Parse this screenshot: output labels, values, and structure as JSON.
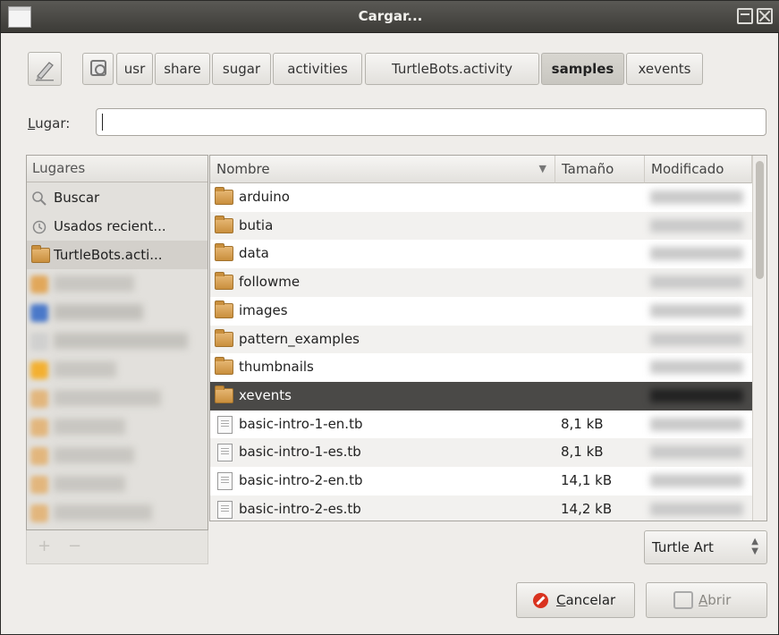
{
  "window": {
    "title": "Cargar..."
  },
  "path_bar": {
    "crumbs": [
      "usr",
      "share",
      "sugar",
      "activities",
      "TurtleBots.activity",
      "samples",
      "xevents"
    ],
    "active": "samples"
  },
  "location": {
    "label_prefix": "L",
    "label_rest": "ugar:",
    "value": ""
  },
  "places": {
    "header": "Lugares",
    "items": [
      {
        "label": "Buscar",
        "icon": "search-icon"
      },
      {
        "label": "Usados recient...",
        "icon": "recent-icon"
      },
      {
        "label": "TurtleBots.acti...",
        "icon": "folder-icon"
      }
    ]
  },
  "file_list": {
    "columns": {
      "name": "Nombre",
      "size": "Tamaño",
      "modified": "Modificado"
    },
    "sort_indicator": "▼",
    "rows": [
      {
        "name": "arduino",
        "type": "folder",
        "size": ""
      },
      {
        "name": "butia",
        "type": "folder",
        "size": ""
      },
      {
        "name": "data",
        "type": "folder",
        "size": ""
      },
      {
        "name": "followme",
        "type": "folder",
        "size": ""
      },
      {
        "name": "images",
        "type": "folder",
        "size": ""
      },
      {
        "name": "pattern_examples",
        "type": "folder",
        "size": ""
      },
      {
        "name": "thumbnails",
        "type": "folder",
        "size": ""
      },
      {
        "name": "xevents",
        "type": "folder",
        "size": "",
        "selected": true
      },
      {
        "name": "basic-intro-1-en.tb",
        "type": "file",
        "size": "8,1 kB"
      },
      {
        "name": "basic-intro-1-es.tb",
        "type": "file",
        "size": "8,1 kB"
      },
      {
        "name": "basic-intro-2-en.tb",
        "type": "file",
        "size": "14,1 kB"
      },
      {
        "name": "basic-intro-2-es.tb",
        "type": "file",
        "size": "14,2 kB"
      }
    ]
  },
  "filter": {
    "value": "Turtle Art"
  },
  "buttons": {
    "cancel": {
      "mnemonic": "C",
      "rest": "ancelar"
    },
    "open": {
      "mnemonic": "A",
      "rest": "brir"
    }
  },
  "places_footer": {
    "add": "+",
    "remove": "−"
  },
  "colors": {
    "titlebar": "#3c3b37",
    "selection": "#4a4947",
    "cancel_icon": "#d9331f"
  }
}
